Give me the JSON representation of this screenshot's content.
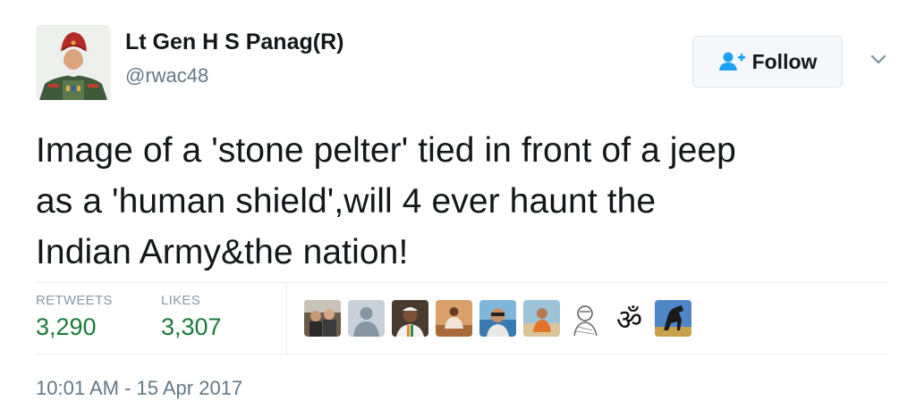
{
  "author": {
    "display_name": "Lt Gen H S Panag(R)",
    "handle": "@rwac48"
  },
  "follow_button": {
    "label": "Follow",
    "icon": "add-user-icon"
  },
  "tweet": {
    "line1": "Image of a 'stone pelter' tied in front of a jeep",
    "line2": "as a 'human shield',will 4 ever haunt the",
    "line3": "Indian Army&the nation!"
  },
  "stats": {
    "retweets_label": "RETWEETS",
    "retweets_value": "3,290",
    "likes_label": "LIKES",
    "likes_value": "3,307"
  },
  "likers": [
    {
      "icon": "avatar-people"
    },
    {
      "icon": "avatar-default"
    },
    {
      "icon": "avatar-man-white-cap"
    },
    {
      "icon": "avatar-meditation"
    },
    {
      "icon": "avatar-man-sea"
    },
    {
      "icon": "avatar-man-beach"
    },
    {
      "icon": "avatar-sketch"
    },
    {
      "icon": "avatar-om",
      "glyph": "ॐ"
    },
    {
      "icon": "avatar-horse"
    }
  ],
  "timestamp": "10:01 AM - 15 Apr 2017",
  "colors": {
    "text": "#14171a",
    "muted": "#657786",
    "stat_value": "#1a7a3a",
    "follow_icon": "#1da1f2",
    "divider": "#e6ecf0"
  }
}
